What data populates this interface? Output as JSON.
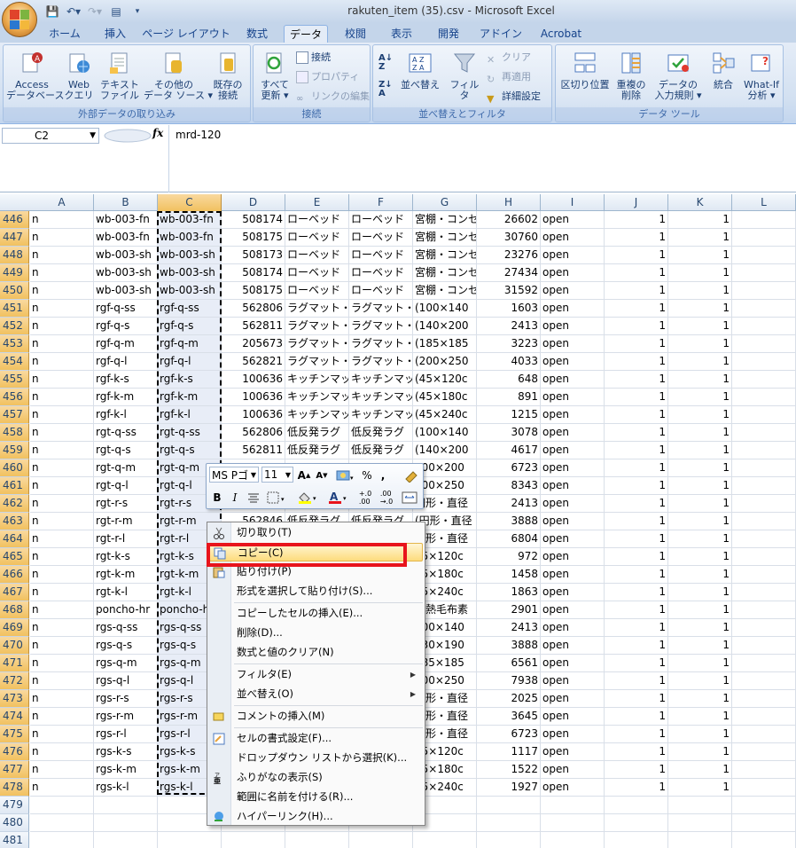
{
  "window": {
    "title": "rakuten_item (35).csv - Microsoft Excel"
  },
  "tabs": [
    "ホーム",
    "挿入",
    "ページ レイアウト",
    "数式",
    "データ",
    "校閲",
    "表示",
    "開発",
    "アドイン",
    "Acrobat"
  ],
  "active_tab": "データ",
  "ribbon": {
    "external": {
      "label": "外部データの取り込み",
      "access": "Access\nデータベース",
      "web": "Web\nクエリ",
      "text": "テキスト\nファイル",
      "other": "その他の\nデータ ソース ▾",
      "existing": "既存の\n接続"
    },
    "connections": {
      "label": "接続",
      "refresh": "すべて\n更新 ▾",
      "conn": "接続",
      "props": "プロパティ",
      "links": "リンクの編集"
    },
    "sort": {
      "label": "並べ替えとフィルタ",
      "sort": "並べ替え",
      "filter": "フィルタ",
      "clear": "クリア",
      "reapply": "再適用",
      "advanced": "詳細設定"
    },
    "tools": {
      "label": "データ ツール",
      "split": "区切り位置",
      "dup": "重複の\n削除",
      "valid": "データの\n入力規則 ▾",
      "consolidate": "統合",
      "whatif": "What-If\n分析 ▾"
    }
  },
  "formula_bar": {
    "cell": "C2",
    "fx": "fx",
    "value": "mrd-120"
  },
  "columns": [
    "A",
    "B",
    "C",
    "D",
    "E",
    "F",
    "G",
    "H",
    "I",
    "J",
    "K",
    "L"
  ],
  "rows": [
    {
      "n": "446",
      "a": "n",
      "b": "wb-003-fn",
      "c": "wb-003-fn",
      "d": "508174",
      "e": "ローベッド",
      "f": "ローベッド",
      "g": "宮棚・コンセ",
      "h": "26602",
      "i": "open",
      "j": "1",
      "k": "1"
    },
    {
      "n": "447",
      "a": "n",
      "b": "wb-003-fn",
      "c": "wb-003-fn",
      "d": "508175",
      "e": "ローベッド",
      "f": "ローベッド",
      "g": "宮棚・コンセ",
      "h": "30760",
      "i": "open",
      "j": "1",
      "k": "1"
    },
    {
      "n": "448",
      "a": "n",
      "b": "wb-003-sh",
      "c": "wb-003-sh",
      "d": "508173",
      "e": "ローベッド",
      "f": "ローベッド",
      "g": "宮棚・コンセ",
      "h": "23276",
      "i": "open",
      "j": "1",
      "k": "1"
    },
    {
      "n": "449",
      "a": "n",
      "b": "wb-003-sh",
      "c": "wb-003-sh",
      "d": "508174",
      "e": "ローベッド",
      "f": "ローベッド",
      "g": "宮棚・コンセ",
      "h": "27434",
      "i": "open",
      "j": "1",
      "k": "1"
    },
    {
      "n": "450",
      "a": "n",
      "b": "wb-003-sh",
      "c": "wb-003-sh",
      "d": "508175",
      "e": "ローベッド",
      "f": "ローベッド",
      "g": "宮棚・コンセ",
      "h": "31592",
      "i": "open",
      "j": "1",
      "k": "1"
    },
    {
      "n": "451",
      "a": "n",
      "b": "rgf-q-ss",
      "c": "rgf-q-ss",
      "d": "562806",
      "e": "ラグマット・",
      "f": "ラグマット・",
      "g": "(100×140",
      "h": "1603",
      "i": "open",
      "j": "1",
      "k": "1"
    },
    {
      "n": "452",
      "a": "n",
      "b": "rgf-q-s",
      "c": "rgf-q-s",
      "d": "562811",
      "e": "ラグマット・",
      "f": "ラグマット・",
      "g": "(140×200",
      "h": "2413",
      "i": "open",
      "j": "1",
      "k": "1"
    },
    {
      "n": "453",
      "a": "n",
      "b": "rgf-q-m",
      "c": "rgf-q-m",
      "d": "205673",
      "e": "ラグマット・",
      "f": "ラグマット・",
      "g": "(185×185",
      "h": "3223",
      "i": "open",
      "j": "1",
      "k": "1"
    },
    {
      "n": "454",
      "a": "n",
      "b": "rgf-q-l",
      "c": "rgf-q-l",
      "d": "562821",
      "e": "ラグマット・",
      "f": "ラグマット・",
      "g": "(200×250",
      "h": "4033",
      "i": "open",
      "j": "1",
      "k": "1"
    },
    {
      "n": "455",
      "a": "n",
      "b": "rgf-k-s",
      "c": "rgf-k-s",
      "d": "100636",
      "e": "キッチンマッ",
      "f": "キッチンマッ",
      "g": "(45×120c",
      "h": "648",
      "i": "open",
      "j": "1",
      "k": "1"
    },
    {
      "n": "456",
      "a": "n",
      "b": "rgf-k-m",
      "c": "rgf-k-m",
      "d": "100636",
      "e": "キッチンマッ",
      "f": "キッチンマッ",
      "g": "(45×180c",
      "h": "891",
      "i": "open",
      "j": "1",
      "k": "1"
    },
    {
      "n": "457",
      "a": "n",
      "b": "rgf-k-l",
      "c": "rgf-k-l",
      "d": "100636",
      "e": "キッチンマッ",
      "f": "キッチンマッ",
      "g": "(45×240c",
      "h": "1215",
      "i": "open",
      "j": "1",
      "k": "1"
    },
    {
      "n": "458",
      "a": "n",
      "b": "rgt-q-ss",
      "c": "rgt-q-ss",
      "d": "562806",
      "e": "低反発ラグ",
      "f": "低反発ラグ",
      "g": "(100×140",
      "h": "3078",
      "i": "open",
      "j": "1",
      "k": "1"
    },
    {
      "n": "459",
      "a": "n",
      "b": "rgt-q-s",
      "c": "rgt-q-s",
      "d": "562811",
      "e": "低反発ラグ",
      "f": "低反発ラグ",
      "g": "(140×200",
      "h": "4617",
      "i": "open",
      "j": "1",
      "k": "1"
    },
    {
      "n": "460",
      "a": "n",
      "b": "rgt-q-m",
      "c": "rgt-q-m",
      "d": "",
      "e": "",
      "f": "",
      "g": "200×200",
      "h": "6723",
      "i": "open",
      "j": "1",
      "k": "1"
    },
    {
      "n": "461",
      "a": "n",
      "b": "rgt-q-l",
      "c": "rgt-q-l",
      "d": "",
      "e": "",
      "f": "",
      "g": "200×250",
      "h": "8343",
      "i": "open",
      "j": "1",
      "k": "1"
    },
    {
      "n": "462",
      "a": "n",
      "b": "rgt-r-s",
      "c": "rgt-r-s",
      "d": "",
      "e": "",
      "f": "",
      "g": "円形・直径",
      "h": "2413",
      "i": "open",
      "j": "1",
      "k": "1"
    },
    {
      "n": "463",
      "a": "n",
      "b": "rgt-r-m",
      "c": "rgt-r-m",
      "d": "562846",
      "e": "低反発ラグ",
      "f": "低反発ラグ",
      "g": "(円形・直径",
      "h": "3888",
      "i": "open",
      "j": "1",
      "k": "1"
    },
    {
      "n": "464",
      "a": "n",
      "b": "rgt-r-l",
      "c": "rgt-r-l",
      "d": "",
      "e": "",
      "f": "",
      "g": "円形・直径",
      "h": "6804",
      "i": "open",
      "j": "1",
      "k": "1"
    },
    {
      "n": "465",
      "a": "n",
      "b": "rgt-k-s",
      "c": "rgt-k-s",
      "d": "",
      "e": "",
      "f": "",
      "g": "45×120c",
      "h": "972",
      "i": "open",
      "j": "1",
      "k": "1"
    },
    {
      "n": "466",
      "a": "n",
      "b": "rgt-k-m",
      "c": "rgt-k-m",
      "d": "",
      "e": "",
      "f": "",
      "g": "45×180c",
      "h": "1458",
      "i": "open",
      "j": "1",
      "k": "1"
    },
    {
      "n": "467",
      "a": "n",
      "b": "rgt-k-l",
      "c": "rgt-k-l",
      "d": "",
      "e": "",
      "f": "",
      "g": "45×240c",
      "h": "1863",
      "i": "open",
      "j": "1",
      "k": "1"
    },
    {
      "n": "468",
      "a": "n",
      "b": "poncho-hr",
      "c": "poncho-hr",
      "d": "",
      "e": "",
      "f": "",
      "g": "蓄熱毛布素",
      "h": "2901",
      "i": "open",
      "j": "1",
      "k": "1"
    },
    {
      "n": "469",
      "a": "n",
      "b": "rgs-q-ss",
      "c": "rgs-q-ss",
      "d": "",
      "e": "",
      "f": "",
      "g": "100×140",
      "h": "2413",
      "i": "open",
      "j": "1",
      "k": "1"
    },
    {
      "n": "470",
      "a": "n",
      "b": "rgs-q-s",
      "c": "rgs-q-s",
      "d": "",
      "e": "",
      "f": "",
      "g": "130×190",
      "h": "3888",
      "i": "open",
      "j": "1",
      "k": "1"
    },
    {
      "n": "471",
      "a": "n",
      "b": "rgs-q-m",
      "c": "rgs-q-m",
      "d": "",
      "e": "",
      "f": "",
      "g": "185×185",
      "h": "6561",
      "i": "open",
      "j": "1",
      "k": "1"
    },
    {
      "n": "472",
      "a": "n",
      "b": "rgs-q-l",
      "c": "rgs-q-l",
      "d": "",
      "e": "",
      "f": "",
      "g": "200×250",
      "h": "7938",
      "i": "open",
      "j": "1",
      "k": "1"
    },
    {
      "n": "473",
      "a": "n",
      "b": "rgs-r-s",
      "c": "rgs-r-s",
      "d": "",
      "e": "",
      "f": "",
      "g": "円形・直径",
      "h": "2025",
      "i": "open",
      "j": "1",
      "k": "1"
    },
    {
      "n": "474",
      "a": "n",
      "b": "rgs-r-m",
      "c": "rgs-r-m",
      "d": "",
      "e": "",
      "f": "",
      "g": "円形・直径",
      "h": "3645",
      "i": "open",
      "j": "1",
      "k": "1"
    },
    {
      "n": "475",
      "a": "n",
      "b": "rgs-r-l",
      "c": "rgs-r-l",
      "d": "",
      "e": "",
      "f": "",
      "g": "円形・直径",
      "h": "6723",
      "i": "open",
      "j": "1",
      "k": "1"
    },
    {
      "n": "476",
      "a": "n",
      "b": "rgs-k-s",
      "c": "rgs-k-s",
      "d": "",
      "e": "",
      "f": "",
      "g": "45×120c",
      "h": "1117",
      "i": "open",
      "j": "1",
      "k": "1"
    },
    {
      "n": "477",
      "a": "n",
      "b": "rgs-k-m",
      "c": "rgs-k-m",
      "d": "",
      "e": "",
      "f": "",
      "g": "45×180c",
      "h": "1522",
      "i": "open",
      "j": "1",
      "k": "1"
    },
    {
      "n": "478",
      "a": "n",
      "b": "rgs-k-l",
      "c": "rgs-k-l",
      "d": "",
      "e": "",
      "f": "",
      "g": "45×240c",
      "h": "1927",
      "i": "open",
      "j": "1",
      "k": "1"
    },
    {
      "n": "479"
    },
    {
      "n": "480"
    },
    {
      "n": "481"
    }
  ],
  "minitoolbar": {
    "font": "MS Pゴ",
    "size": "11",
    "bold": "B",
    "italic": "I",
    "percent": "%",
    "comma": ","
  },
  "context_menu": [
    {
      "label": "切り取り(T)",
      "icon": "scissors-icon"
    },
    {
      "label": "コピー(C)",
      "icon": "copy-icon",
      "highlight": true
    },
    {
      "label": "貼り付け(P)",
      "icon": "paste-icon"
    },
    {
      "label": "形式を選択して貼り付け(S)...",
      "icon": ""
    },
    {
      "sep": true
    },
    {
      "label": "コピーしたセルの挿入(E)...",
      "icon": ""
    },
    {
      "label": "削除(D)...",
      "icon": ""
    },
    {
      "label": "数式と値のクリア(N)",
      "icon": ""
    },
    {
      "sep": true
    },
    {
      "label": "フィルタ(E)",
      "icon": "",
      "sub": true
    },
    {
      "label": "並べ替え(O)",
      "icon": "",
      "sub": true
    },
    {
      "sep": true
    },
    {
      "label": "コメントの挿入(M)",
      "icon": "comment-icon"
    },
    {
      "sep": true
    },
    {
      "label": "セルの書式設定(F)...",
      "icon": "format-cells-icon"
    },
    {
      "label": "ドロップダウン リストから選択(K)...",
      "icon": ""
    },
    {
      "label": "ふりがなの表示(S)",
      "icon": "furigana-icon"
    },
    {
      "label": "範囲に名前を付ける(R)...",
      "icon": ""
    },
    {
      "label": "ハイパーリンク(H)...",
      "icon": "hyperlink-icon"
    }
  ]
}
